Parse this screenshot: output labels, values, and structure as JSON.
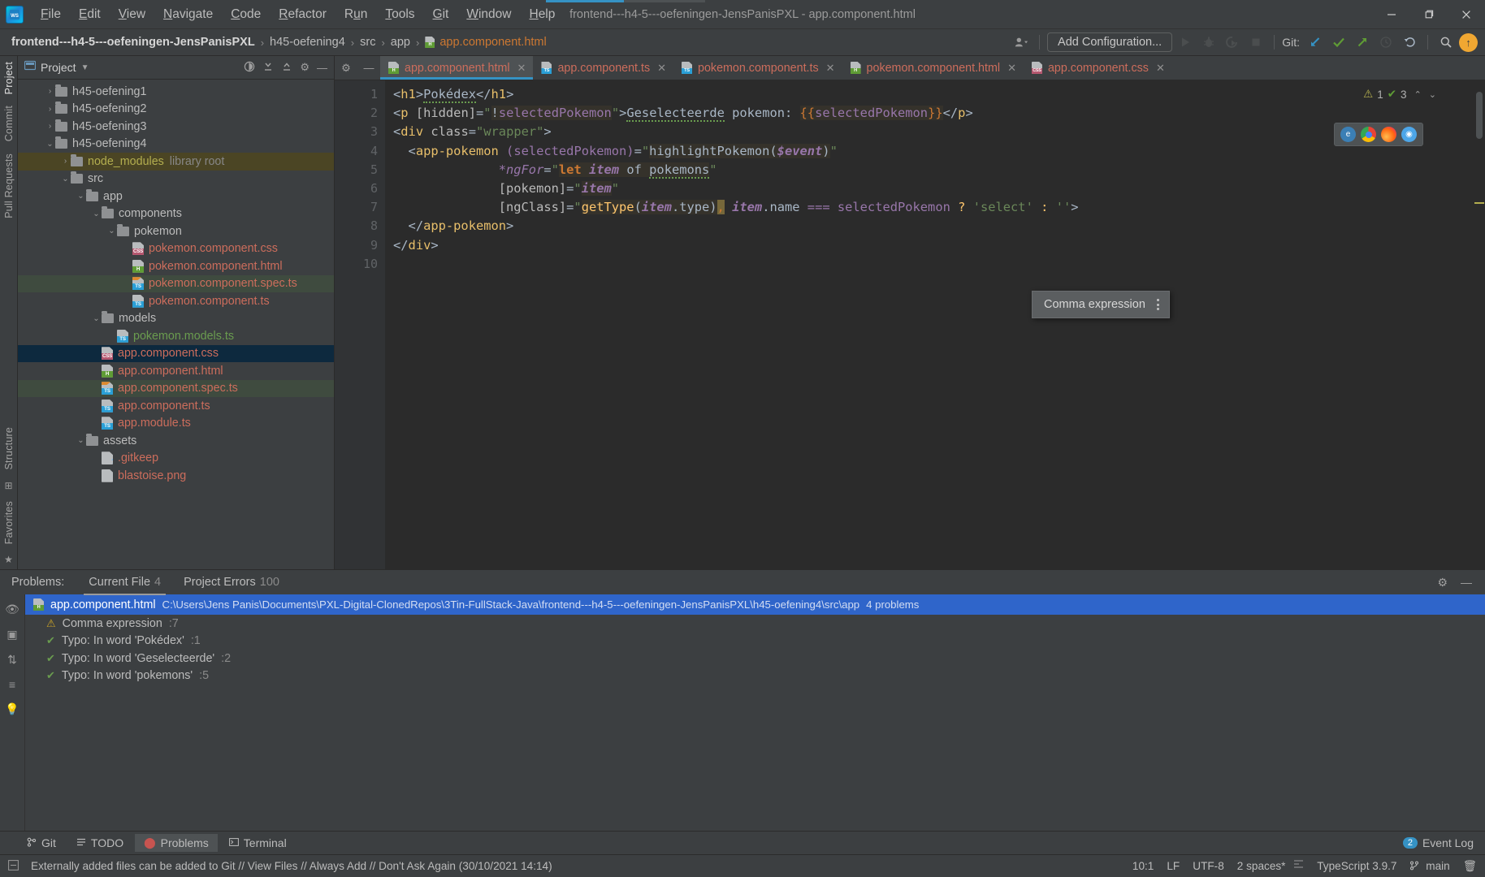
{
  "window": {
    "title": "frontend---h4-5---oefeningen-JensPanisPXL - app.component.html",
    "logo_text": "WS",
    "minimize": "—",
    "maximize": "❐",
    "close": "✕"
  },
  "menu": {
    "items": [
      {
        "label": "File"
      },
      {
        "label": "Edit"
      },
      {
        "label": "View"
      },
      {
        "label": "Navigate"
      },
      {
        "label": "Code"
      },
      {
        "label": "Refactor"
      },
      {
        "label": "Run"
      },
      {
        "label": "Tools"
      },
      {
        "label": "Git"
      },
      {
        "label": "Window"
      },
      {
        "label": "Help"
      }
    ]
  },
  "navbar": {
    "crumbs": [
      {
        "label": "frontend---h4-5---oefeningen-JensPanisPXL"
      },
      {
        "label": "h45-oefening4"
      },
      {
        "label": "src"
      },
      {
        "label": "app"
      },
      {
        "label": "app.component.html"
      }
    ],
    "separator": "›",
    "add_configuration": "Add Configuration...",
    "git_label": "Git:",
    "update_badge": "↑"
  },
  "project": {
    "title": "Project",
    "tree": [
      {
        "indent": 1,
        "arrow": "›",
        "type": "folder",
        "label": "h45-oefening1",
        "color": "grey"
      },
      {
        "indent": 1,
        "arrow": "›",
        "type": "folder",
        "label": "h45-oefening2",
        "color": "grey"
      },
      {
        "indent": 1,
        "arrow": "›",
        "type": "folder",
        "label": "h45-oefening3",
        "color": "grey"
      },
      {
        "indent": 1,
        "arrow": "⌄",
        "type": "folder",
        "label": "h45-oefening4",
        "color": "grey"
      },
      {
        "indent": 2,
        "arrow": "›",
        "type": "folder",
        "label": "node_modules",
        "suffix": "library root",
        "color": "yellow",
        "bg": "libroot"
      },
      {
        "indent": 2,
        "arrow": "⌄",
        "type": "folder",
        "label": "src",
        "color": "grey"
      },
      {
        "indent": 3,
        "arrow": "⌄",
        "type": "folder",
        "label": "app",
        "color": "grey"
      },
      {
        "indent": 4,
        "arrow": "⌄",
        "type": "folder",
        "label": "components",
        "color": "grey"
      },
      {
        "indent": 5,
        "arrow": "⌄",
        "type": "folder",
        "label": "pokemon",
        "color": "grey"
      },
      {
        "indent": 6,
        "arrow": "",
        "type": "file",
        "badge": "CSS",
        "label": "pokemon.component.css",
        "color": "red"
      },
      {
        "indent": 6,
        "arrow": "",
        "type": "file",
        "badge": "H",
        "label": "pokemon.component.html",
        "color": "red"
      },
      {
        "indent": 6,
        "arrow": "",
        "type": "file",
        "badge": "TS",
        "spec": true,
        "label": "pokemon.component.spec.ts",
        "color": "red",
        "bg": "spec"
      },
      {
        "indent": 6,
        "arrow": "",
        "type": "file",
        "badge": "TS",
        "label": "pokemon.component.ts",
        "color": "red"
      },
      {
        "indent": 4,
        "arrow": "⌄",
        "type": "folder",
        "label": "models",
        "color": "grey"
      },
      {
        "indent": 5,
        "arrow": "",
        "type": "file",
        "badge": "TS",
        "label": "pokemon.models.ts",
        "color": "green"
      },
      {
        "indent": 4,
        "arrow": "",
        "type": "file",
        "badge": "CSS",
        "label": "app.component.css",
        "color": "red",
        "bg": "sel"
      },
      {
        "indent": 4,
        "arrow": "",
        "type": "file",
        "badge": "H",
        "label": "app.component.html",
        "color": "red"
      },
      {
        "indent": 4,
        "arrow": "",
        "type": "file",
        "badge": "TS",
        "spec": true,
        "label": "app.component.spec.ts",
        "color": "red",
        "bg": "spec"
      },
      {
        "indent": 4,
        "arrow": "",
        "type": "file",
        "badge": "TS",
        "label": "app.component.ts",
        "color": "red"
      },
      {
        "indent": 4,
        "arrow": "",
        "type": "file",
        "badge": "TS",
        "label": "app.module.ts",
        "color": "red"
      },
      {
        "indent": 3,
        "arrow": "⌄",
        "type": "folder",
        "label": "assets",
        "color": "grey"
      },
      {
        "indent": 4,
        "arrow": "",
        "type": "file",
        "badge": "",
        "gitq": true,
        "label": ".gitkeep",
        "color": "red"
      },
      {
        "indent": 4,
        "arrow": "",
        "type": "file",
        "badge": "",
        "label": "blastoise.png",
        "color": "red"
      }
    ]
  },
  "left_strip": {
    "tabs": [
      "Project",
      "Commit",
      "Pull Requests"
    ],
    "bottom_tabs": [
      "Structure",
      "Favorites"
    ]
  },
  "tabs": [
    {
      "label": "app.component.html",
      "badge": "H",
      "active": true
    },
    {
      "label": "app.component.ts",
      "badge": "TS",
      "active": false
    },
    {
      "label": "pokemon.component.ts",
      "badge": "TS",
      "active": false
    },
    {
      "label": "pokemon.component.html",
      "badge": "H",
      "active": false
    },
    {
      "label": "app.component.css",
      "badge": "CSS",
      "active": false
    }
  ],
  "editor": {
    "line_numbers": [
      "1",
      "2",
      "3",
      "4",
      "5",
      "6",
      "7",
      "8",
      "9",
      "10"
    ],
    "lines": [
      "<h1>Pokédex</h1>",
      "<p [hidden]=\"!selectedPokemon\">Geselecteerde pokemon: {{selectedPokemon}}</p>",
      "<div class=\"wrapper\">",
      "  <app-pokemon (selectedPokemon)=\"highlightPokemon($event)\"",
      "               *ngFor=\"let item of pokemons\"",
      "               [pokemon]=\"item\"",
      "               [ngClass]=\"getType(item.type), item.name === selectedPokemon ? 'select' : ''\">",
      "  </app-pokemon>",
      "</div>",
      ""
    ],
    "inspection": {
      "warnings": "1",
      "oks": "3"
    },
    "tooltip": {
      "text": "Comma expression"
    }
  },
  "problems": {
    "title": "Problems:",
    "tabs": [
      {
        "label": "Current File",
        "count": "4",
        "active": true
      },
      {
        "label": "Project Errors",
        "count": "100",
        "active": false
      }
    ],
    "file": {
      "name": "app.component.html",
      "path": "C:\\Users\\Jens Panis\\Documents\\PXL-Digital-ClonedRepos\\3Tin-FullStack-Java\\frontend---h4-5---oefeningen-JensPanisPXL\\h45-oefening4\\src\\app",
      "count": "4 problems"
    },
    "items": [
      {
        "icon": "warning",
        "text": "Comma expression",
        "line": ":7"
      },
      {
        "icon": "typo",
        "text": "Typo: In word 'Pokédex'",
        "line": ":1"
      },
      {
        "icon": "typo",
        "text": "Typo: In word 'Geselecteerde'",
        "line": ":2"
      },
      {
        "icon": "typo",
        "text": "Typo: In word 'pokemons'",
        "line": ":5"
      }
    ]
  },
  "bottom_tabs": [
    {
      "label": "Git",
      "icon": "git-icon",
      "active": false
    },
    {
      "label": "TODO",
      "icon": "todo-icon",
      "active": false
    },
    {
      "label": "Problems",
      "icon": "problems-icon",
      "active": true
    },
    {
      "label": "Terminal",
      "icon": "terminal-icon",
      "active": false
    }
  ],
  "event_log": {
    "label": "Event Log",
    "badge": "2"
  },
  "status": {
    "message": "Externally added files can be added to Git // View Files // Always Add // Don't Ask Again (30/10/2021 14:14)",
    "caret": "10:1",
    "line_sep": "LF",
    "encoding": "UTF-8",
    "indent": "2 spaces*",
    "language": "TypeScript 3.9.7",
    "branch": "main"
  },
  "colors": {
    "accent": "#3592c4",
    "warning": "#b3ae4f",
    "error": "#c75450",
    "ok": "#5f9c35",
    "selection": "#0d293e"
  }
}
